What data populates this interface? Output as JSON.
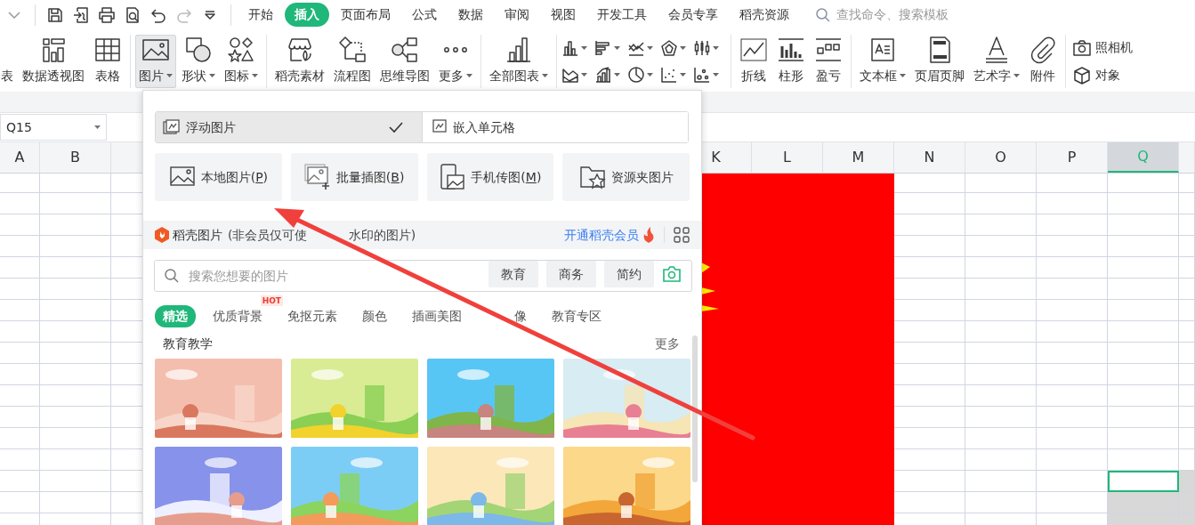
{
  "quick_access": [
    {
      "kind": "collapse",
      "disabled": false
    },
    {
      "kind": "save",
      "disabled": false
    },
    {
      "kind": "export",
      "disabled": false
    },
    {
      "kind": "print",
      "disabled": false
    },
    {
      "kind": "preview",
      "disabled": false
    },
    {
      "kind": "undo",
      "disabled": false
    },
    {
      "kind": "redo",
      "disabled": true
    },
    {
      "kind": "customize",
      "disabled": false
    }
  ],
  "tabs": [
    {
      "label": "开始",
      "selected": false
    },
    {
      "label": "插入",
      "selected": true
    },
    {
      "label": "页面布局",
      "selected": false
    },
    {
      "label": "公式",
      "selected": false
    },
    {
      "label": "数据",
      "selected": false
    },
    {
      "label": "审阅",
      "selected": false
    },
    {
      "label": "视图",
      "selected": false
    },
    {
      "label": "开发工具",
      "selected": false
    },
    {
      "label": "会员专享",
      "selected": false
    },
    {
      "label": "稻壳资源",
      "selected": false
    }
  ],
  "search": {
    "placeholder": "查找命令、搜索模板"
  },
  "ribbon": [
    {
      "kind": "large",
      "items": [
        {
          "kind": "clipped",
          "label": "表",
          "dropdown": false,
          "pressed": false
        },
        {
          "kind": "pivot",
          "label": "数据透视图",
          "dropdown": false,
          "pressed": false
        },
        {
          "kind": "table",
          "label": "表格",
          "dropdown": false,
          "pressed": false
        }
      ]
    },
    {
      "kind": "large",
      "items": [
        {
          "label": "图片",
          "dropdown": true,
          "pressed": true
        },
        {
          "kind": "shape",
          "label": "形状",
          "dropdown": true,
          "pressed": false
        },
        {
          "kind": "icons",
          "label": "图标",
          "dropdown": true,
          "pressed": false
        }
      ]
    },
    {
      "kind": "large",
      "items": [
        {
          "kind": "store",
          "label": "稻壳素材",
          "dropdown": false,
          "pressed": false
        },
        {
          "kind": "flow",
          "label": "流程图",
          "dropdown": false,
          "pressed": false
        },
        {
          "kind": "mindmap",
          "label": "思维导图",
          "dropdown": false,
          "pressed": false
        },
        {
          "kind": "more",
          "label": "更多",
          "dropdown": true,
          "pressed": false
        }
      ]
    },
    {
      "kind": "large",
      "items": [
        {
          "kind": "allcharts",
          "label": "全部图表",
          "dropdown": true,
          "pressed": false
        }
      ]
    },
    {
      "kind": "grid",
      "items": [
        {
          "kind": "bar"
        },
        {
          "kind": "hbar"
        },
        {
          "kind": "linechart"
        },
        {
          "kind": "radar"
        },
        {
          "kind": "stock"
        },
        {
          "kind": "area"
        },
        {
          "kind": "combo"
        },
        {
          "kind": "pie"
        },
        {
          "kind": "scatter"
        },
        {
          "kind": "bubble"
        }
      ]
    },
    {
      "kind": "large",
      "items": [
        {
          "kind": "sparkline",
          "label": "折线",
          "dropdown": false,
          "pressed": false
        },
        {
          "kind": "sparkcol",
          "label": "柱形",
          "dropdown": false,
          "pressed": false
        },
        {
          "kind": "winloss",
          "label": "盈亏",
          "dropdown": false,
          "pressed": false
        }
      ]
    },
    {
      "kind": "large",
      "items": [
        {
          "kind": "textbox",
          "label": "文本框",
          "dropdown": true,
          "pressed": false
        },
        {
          "kind": "header",
          "label": "页眉页脚",
          "dropdown": false,
          "pressed": false
        },
        {
          "kind": "wordart",
          "label": "艺术字",
          "dropdown": true,
          "pressed": false
        },
        {
          "kind": "clip",
          "label": "附件",
          "dropdown": false,
          "pressed": false
        }
      ]
    },
    {
      "kind": "stack",
      "items": [
        {
          "kind": "camera",
          "label": "照相机"
        },
        {
          "kind": "cube",
          "label": "对象"
        }
      ]
    }
  ],
  "name_box": {
    "value": "Q15"
  },
  "columns_left": [
    {
      "label": "A",
      "selected": false
    },
    {
      "label": "B",
      "selected": false
    }
  ],
  "columns_right": [
    {
      "label": "K",
      "selected": false
    },
    {
      "label": "L",
      "selected": false
    },
    {
      "label": "M",
      "selected": false
    },
    {
      "label": "N",
      "selected": false
    },
    {
      "label": "O",
      "selected": false
    },
    {
      "label": "P",
      "selected": false
    },
    {
      "label": "Q",
      "selected": true
    }
  ],
  "picture_menu": {
    "modes": [
      {
        "label": "浮动图片",
        "selected": true
      },
      {
        "label": "嵌入单元格",
        "selected": false
      }
    ],
    "sources": [
      {
        "kind": "local",
        "label": "本地图片(P)"
      },
      {
        "kind": "batch",
        "label": "批量插图(B)"
      },
      {
        "kind": "phone",
        "label": "手机传图(M)"
      },
      {
        "kind": "folder",
        "label": "资源夹图片"
      }
    ],
    "docer": {
      "title": "稻壳图片",
      "note": "(非会员仅可使",
      "note_tail": "水印的图片)",
      "link": "开通稻壳会员"
    },
    "search": {
      "placeholder": "搜索您想要的图片",
      "tags": [
        "教育",
        "商务",
        "简约"
      ]
    },
    "categories": [
      {
        "label": "精选",
        "selected": true
      },
      {
        "label": "优质背景",
        "selected": false,
        "badge": "HOT"
      },
      {
        "label": "免抠元素",
        "selected": false
      },
      {
        "label": "颜色",
        "selected": false
      },
      {
        "label": "插画美图",
        "selected": false
      },
      {
        "label": "像",
        "selected": false,
        "covered_before": true
      },
      {
        "label": "教育专区",
        "selected": false
      }
    ],
    "section": {
      "title": "教育教学",
      "more": "更多"
    }
  },
  "annotations": [
    {
      "kind": "arrow"
    }
  ]
}
